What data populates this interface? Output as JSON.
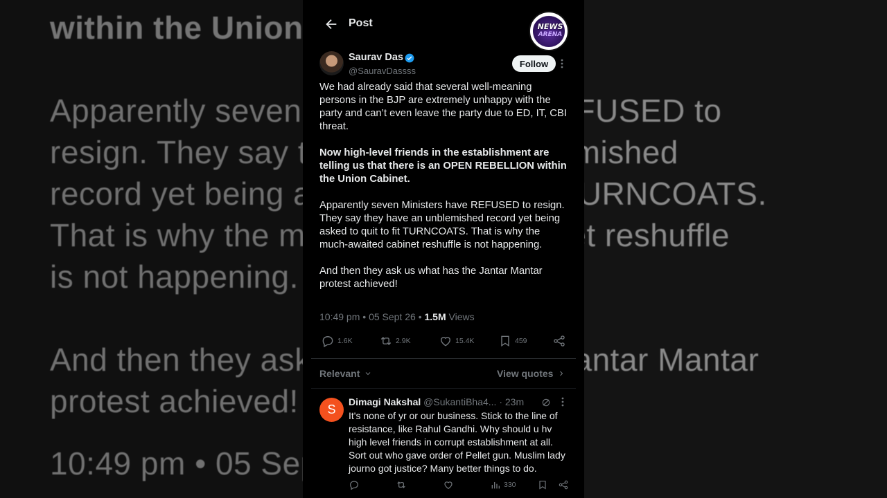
{
  "background": {
    "lines": [
      "within the Union Cabinet.",
      "Apparently seven Ministers have REFUSED to",
      "resign. They say they have an unblemished",
      "record yet being asked to quit to fit TURNCOATS.",
      "That is why the much-awaited cabinet reshuffle",
      "is not happening.",
      "And then they ask us what has the Jantar Mantar",
      "protest achieved!",
      "10:49 pm • 05 Sept 26 • 1.5M Views"
    ]
  },
  "header": {
    "title": "Post",
    "logo": {
      "line1": "NEWS",
      "line2": "ARENA"
    }
  },
  "tweet": {
    "author_name": "Saurav Das",
    "author_handle": "@SauravDassss",
    "follow_label": "Follow",
    "paragraphs": [
      "We had already said that several well-meaning persons in the BJP are extremely unhappy with the party and can’t even leave the party due to ED, IT, CBI threat.",
      "Now high-level friends in the establishment are telling us that there is an OPEN REBELLION within the Union Cabinet.",
      "Apparently seven Ministers have REFUSED to resign. They say they have an unblemished record yet being asked to quit to fit TURNCOATS. That is why the much-awaited cabinet reshuffle is not happening.",
      "And then they ask us what has the Jantar Mantar protest achieved!"
    ],
    "time": "10:49 pm",
    "date": "05 Sept 26",
    "views_count": "1.5M",
    "views_label": "Views",
    "stats": {
      "replies": "1.6K",
      "reposts": "2.9K",
      "likes": "15.4K",
      "bookmarks": "459"
    }
  },
  "sort": {
    "relevant_label": "Relevant",
    "view_quotes_label": "View quotes"
  },
  "reply": {
    "avatar_letter": "S",
    "name": "Dimagi Nakshal",
    "handle": "@SukantiBha4...",
    "time": "23m",
    "text": "It's none of yr or our business. Stick to the line of resistance, like Rahul Gandhi. Why should u hv high level friends in corrupt establishment at all. Sort out who gave order of Pellet gun. Muslim lady journo got justice? Many better things to do.",
    "views": "330"
  },
  "colors": {
    "accent_verified": "#1d9bf0",
    "muted": "#71767b",
    "reply_avatar": "#f4511e"
  }
}
